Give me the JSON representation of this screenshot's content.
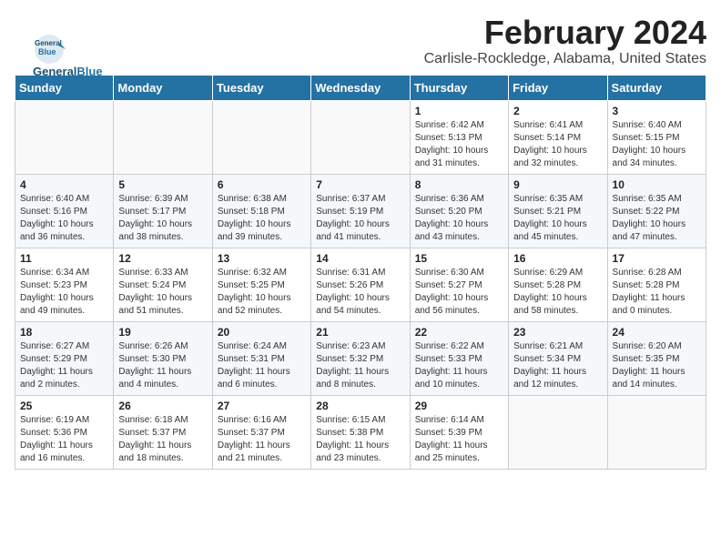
{
  "header": {
    "month_year": "February 2024",
    "location": "Carlisle-Rockledge, Alabama, United States"
  },
  "logo": {
    "line1": "General",
    "line2": "Blue"
  },
  "days_of_week": [
    "Sunday",
    "Monday",
    "Tuesday",
    "Wednesday",
    "Thursday",
    "Friday",
    "Saturday"
  ],
  "weeks": [
    [
      {
        "day": "",
        "info": ""
      },
      {
        "day": "",
        "info": ""
      },
      {
        "day": "",
        "info": ""
      },
      {
        "day": "",
        "info": ""
      },
      {
        "day": "1",
        "info": "Sunrise: 6:42 AM\nSunset: 5:13 PM\nDaylight: 10 hours\nand 31 minutes."
      },
      {
        "day": "2",
        "info": "Sunrise: 6:41 AM\nSunset: 5:14 PM\nDaylight: 10 hours\nand 32 minutes."
      },
      {
        "day": "3",
        "info": "Sunrise: 6:40 AM\nSunset: 5:15 PM\nDaylight: 10 hours\nand 34 minutes."
      }
    ],
    [
      {
        "day": "4",
        "info": "Sunrise: 6:40 AM\nSunset: 5:16 PM\nDaylight: 10 hours\nand 36 minutes."
      },
      {
        "day": "5",
        "info": "Sunrise: 6:39 AM\nSunset: 5:17 PM\nDaylight: 10 hours\nand 38 minutes."
      },
      {
        "day": "6",
        "info": "Sunrise: 6:38 AM\nSunset: 5:18 PM\nDaylight: 10 hours\nand 39 minutes."
      },
      {
        "day": "7",
        "info": "Sunrise: 6:37 AM\nSunset: 5:19 PM\nDaylight: 10 hours\nand 41 minutes."
      },
      {
        "day": "8",
        "info": "Sunrise: 6:36 AM\nSunset: 5:20 PM\nDaylight: 10 hours\nand 43 minutes."
      },
      {
        "day": "9",
        "info": "Sunrise: 6:35 AM\nSunset: 5:21 PM\nDaylight: 10 hours\nand 45 minutes."
      },
      {
        "day": "10",
        "info": "Sunrise: 6:35 AM\nSunset: 5:22 PM\nDaylight: 10 hours\nand 47 minutes."
      }
    ],
    [
      {
        "day": "11",
        "info": "Sunrise: 6:34 AM\nSunset: 5:23 PM\nDaylight: 10 hours\nand 49 minutes."
      },
      {
        "day": "12",
        "info": "Sunrise: 6:33 AM\nSunset: 5:24 PM\nDaylight: 10 hours\nand 51 minutes."
      },
      {
        "day": "13",
        "info": "Sunrise: 6:32 AM\nSunset: 5:25 PM\nDaylight: 10 hours\nand 52 minutes."
      },
      {
        "day": "14",
        "info": "Sunrise: 6:31 AM\nSunset: 5:26 PM\nDaylight: 10 hours\nand 54 minutes."
      },
      {
        "day": "15",
        "info": "Sunrise: 6:30 AM\nSunset: 5:27 PM\nDaylight: 10 hours\nand 56 minutes."
      },
      {
        "day": "16",
        "info": "Sunrise: 6:29 AM\nSunset: 5:28 PM\nDaylight: 10 hours\nand 58 minutes."
      },
      {
        "day": "17",
        "info": "Sunrise: 6:28 AM\nSunset: 5:28 PM\nDaylight: 11 hours\nand 0 minutes."
      }
    ],
    [
      {
        "day": "18",
        "info": "Sunrise: 6:27 AM\nSunset: 5:29 PM\nDaylight: 11 hours\nand 2 minutes."
      },
      {
        "day": "19",
        "info": "Sunrise: 6:26 AM\nSunset: 5:30 PM\nDaylight: 11 hours\nand 4 minutes."
      },
      {
        "day": "20",
        "info": "Sunrise: 6:24 AM\nSunset: 5:31 PM\nDaylight: 11 hours\nand 6 minutes."
      },
      {
        "day": "21",
        "info": "Sunrise: 6:23 AM\nSunset: 5:32 PM\nDaylight: 11 hours\nand 8 minutes."
      },
      {
        "day": "22",
        "info": "Sunrise: 6:22 AM\nSunset: 5:33 PM\nDaylight: 11 hours\nand 10 minutes."
      },
      {
        "day": "23",
        "info": "Sunrise: 6:21 AM\nSunset: 5:34 PM\nDaylight: 11 hours\nand 12 minutes."
      },
      {
        "day": "24",
        "info": "Sunrise: 6:20 AM\nSunset: 5:35 PM\nDaylight: 11 hours\nand 14 minutes."
      }
    ],
    [
      {
        "day": "25",
        "info": "Sunrise: 6:19 AM\nSunset: 5:36 PM\nDaylight: 11 hours\nand 16 minutes."
      },
      {
        "day": "26",
        "info": "Sunrise: 6:18 AM\nSunset: 5:37 PM\nDaylight: 11 hours\nand 18 minutes."
      },
      {
        "day": "27",
        "info": "Sunrise: 6:16 AM\nSunset: 5:37 PM\nDaylight: 11 hours\nand 21 minutes."
      },
      {
        "day": "28",
        "info": "Sunrise: 6:15 AM\nSunset: 5:38 PM\nDaylight: 11 hours\nand 23 minutes."
      },
      {
        "day": "29",
        "info": "Sunrise: 6:14 AM\nSunset: 5:39 PM\nDaylight: 11 hours\nand 25 minutes."
      },
      {
        "day": "",
        "info": ""
      },
      {
        "day": "",
        "info": ""
      }
    ]
  ]
}
